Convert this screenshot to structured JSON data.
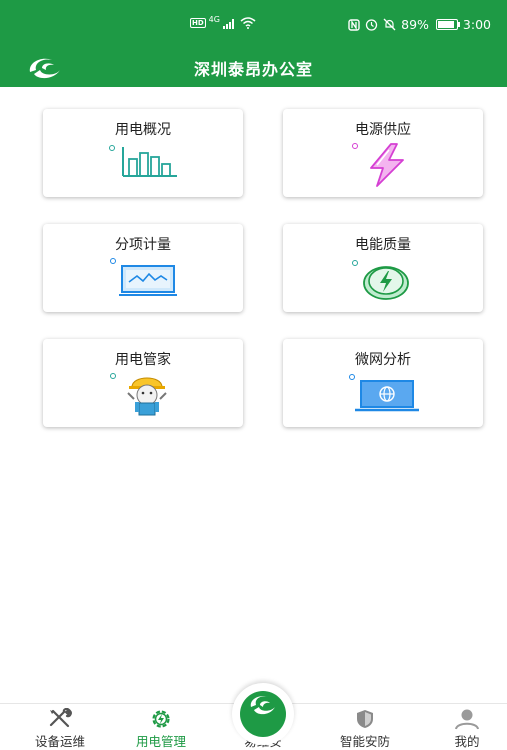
{
  "status_bar": {
    "hd": "HD",
    "network": "4G",
    "battery": "89%",
    "time": "3:00"
  },
  "header": {
    "title": "深圳泰昂办公室"
  },
  "menu": [
    {
      "label": "用电概况",
      "icon": "bar-chart-icon"
    },
    {
      "label": "电源供应",
      "icon": "lightning-icon"
    },
    {
      "label": "分项计量",
      "icon": "monitor-wave-icon"
    },
    {
      "label": "电能质量",
      "icon": "energy-coin-icon"
    },
    {
      "label": "用电管家",
      "icon": "worker-mascot-icon"
    },
    {
      "label": "微网分析",
      "icon": "laptop-globe-icon"
    }
  ],
  "tabs": [
    {
      "label": "设备运维",
      "icon": "tools-icon",
      "active": false
    },
    {
      "label": "用电管理",
      "icon": "gear-bolt-icon",
      "active": true
    },
    {
      "label": "易维安",
      "icon": "app-logo-icon",
      "active": false
    },
    {
      "label": "智能安防",
      "icon": "shield-icon",
      "active": false
    },
    {
      "label": "我的",
      "icon": "user-icon",
      "active": false
    }
  ],
  "colors": {
    "primary": "#1e9a45",
    "teal": "#26a69a",
    "magenta": "#d53fd3",
    "blue": "#1e88e5",
    "inactive": "#555555"
  }
}
